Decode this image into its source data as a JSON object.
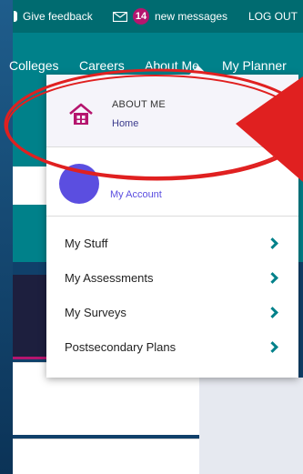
{
  "topbar": {
    "feedback_label": "Give feedback",
    "message_count": "14",
    "messages_label": "new messages",
    "logout_label": "LOG OUT"
  },
  "nav": {
    "items": [
      "Colleges",
      "Careers",
      "About Me",
      "My Planner"
    ]
  },
  "dropdown": {
    "section_title": "ABOUT ME",
    "home_link": "Home",
    "account_link": "My Account",
    "menu_items": [
      {
        "label": "My Stuff",
        "icon": "chevron-right-icon"
      },
      {
        "label": "My Assessments",
        "icon": "chevron-right-icon"
      },
      {
        "label": "My Surveys",
        "icon": "chevron-right-icon"
      },
      {
        "label": "Postsecondary Plans",
        "icon": "chevron-right-icon"
      }
    ]
  },
  "colors": {
    "teal": "#00818a",
    "dark_teal": "#006b70",
    "magenta": "#b5156e",
    "purple": "#5b4ee0",
    "annotation_red": "#e02020"
  }
}
